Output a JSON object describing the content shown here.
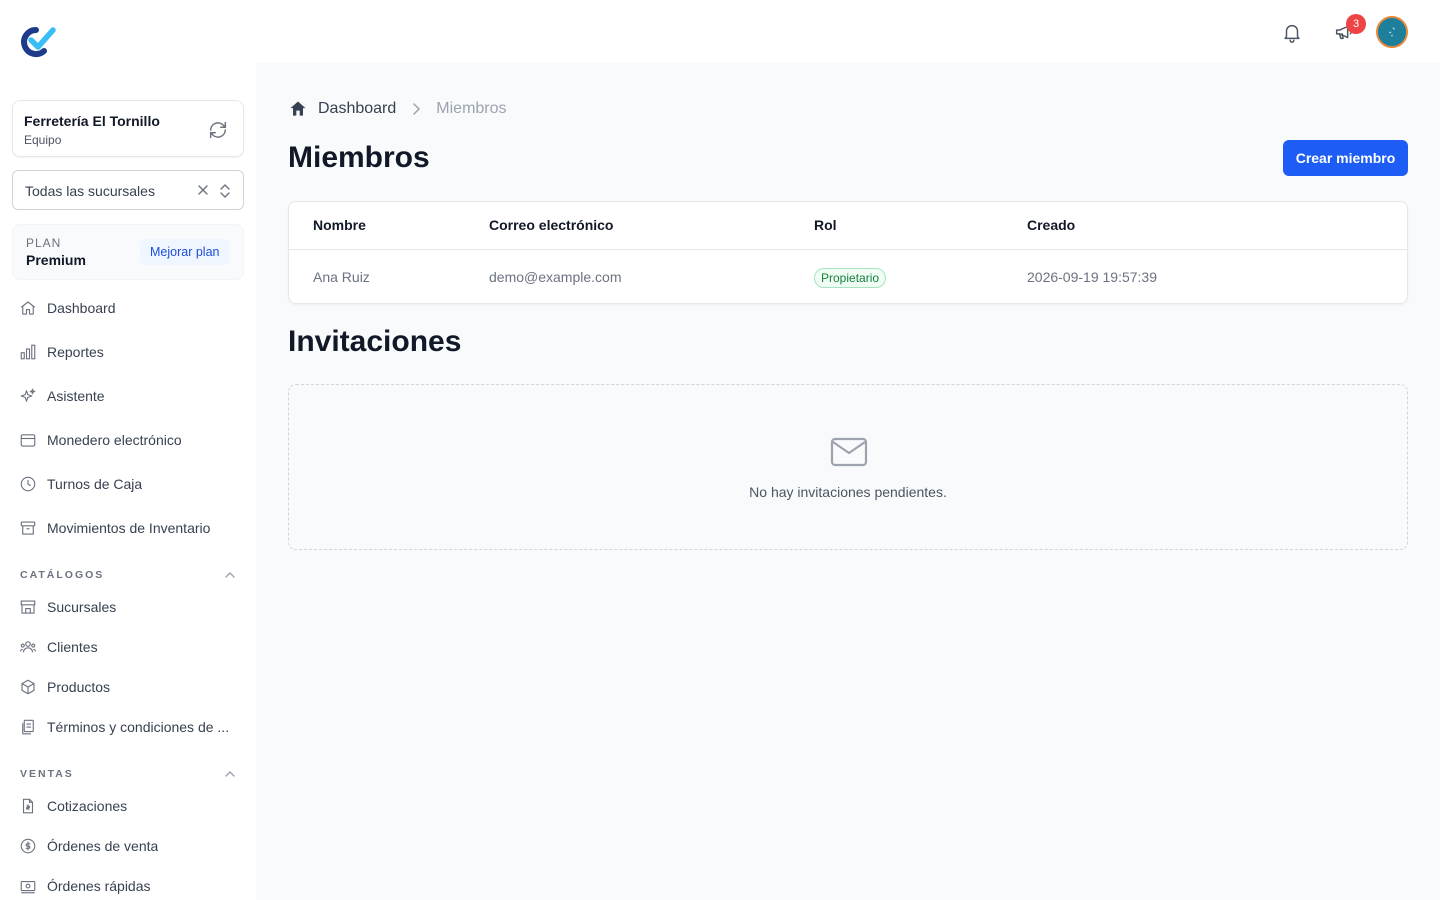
{
  "header": {
    "notifications_count": "3",
    "icons": {
      "bell": "bell-icon",
      "announcements": "megaphone-icon"
    }
  },
  "sidebar": {
    "org": {
      "name": "Ferretería El Tornillo",
      "role": "Equipo"
    },
    "branch_select": {
      "value": "Todas las sucursales"
    },
    "plan": {
      "label": "PLAN",
      "name": "Premium",
      "upgrade_label": "Mejorar plan"
    },
    "main_items": [
      {
        "label": "Dashboard",
        "icon": "home-icon"
      },
      {
        "label": "Reportes",
        "icon": "bar-chart-icon"
      },
      {
        "label": "Asistente",
        "icon": "sparkles-icon"
      },
      {
        "label": "Monedero electrónico",
        "icon": "wallet-icon"
      },
      {
        "label": "Turnos de Caja",
        "icon": "clock-icon"
      },
      {
        "label": "Movimientos de Inventario",
        "icon": "archive-box-icon"
      }
    ],
    "sections": [
      {
        "title": "CATÁLOGOS",
        "items": [
          {
            "label": "Sucursales",
            "icon": "storefront-icon"
          },
          {
            "label": "Clientes",
            "icon": "users-icon"
          },
          {
            "label": "Productos",
            "icon": "cube-icon"
          },
          {
            "label": "Términos y condiciones de ...",
            "icon": "documents-icon"
          }
        ]
      },
      {
        "title": "VENTAS",
        "items": [
          {
            "label": "Cotizaciones",
            "icon": "document-dollar-icon"
          },
          {
            "label": "Órdenes de venta",
            "icon": "currency-circle-icon"
          },
          {
            "label": "Órdenes rápidas",
            "icon": "cash-register-icon"
          }
        ]
      }
    ]
  },
  "breadcrumb": {
    "home": "Dashboard",
    "current": "Miembros"
  },
  "page": {
    "title": "Miembros",
    "create_button": "Crear miembro",
    "table": {
      "headers": [
        "Nombre",
        "Correo electrónico",
        "Rol",
        "Creado"
      ],
      "rows": [
        {
          "name": "Ana Ruiz",
          "email": "demo@example.com",
          "role": "Propietario",
          "created": "2026-09-19 19:57:39"
        }
      ]
    },
    "invitations": {
      "title": "Invitaciones",
      "empty_text": "No hay invitaciones pendientes."
    }
  },
  "colors": {
    "primary": "#1d5cf5",
    "badge_red": "#ef4444",
    "role_green": "#15803d",
    "logo_navy": "#1e3a8a",
    "logo_sky": "#38bdf8"
  }
}
